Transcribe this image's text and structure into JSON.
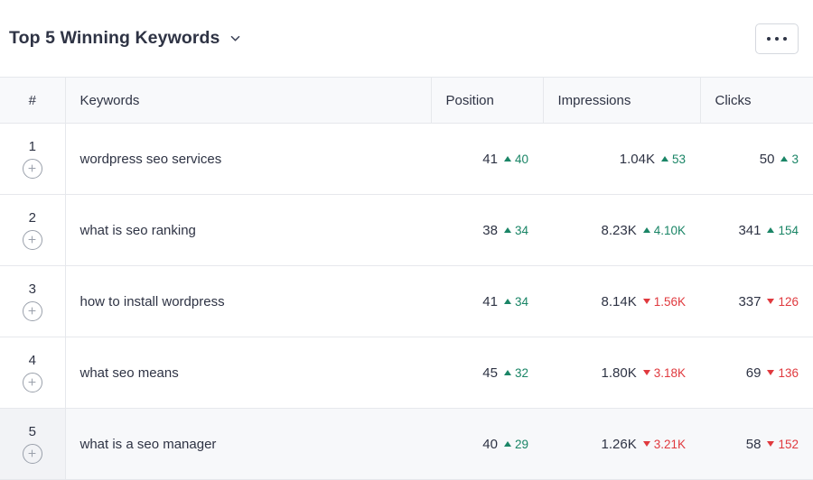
{
  "card": {
    "title": "Top 5 Winning Keywords",
    "title_chevron_icon": "chevron-down-icon",
    "menu_icon": "ellipsis-horizontal-icon"
  },
  "colors": {
    "positive": "#1a8566",
    "negative": "#e0393e",
    "text": "#2e3344",
    "header_bg": "#f8f9fb",
    "border": "#e6e8ec",
    "row_hover_bg": "#f7f8fa"
  },
  "table": {
    "columns": [
      {
        "key": "index",
        "label": "#"
      },
      {
        "key": "keyword",
        "label": "Keywords"
      },
      {
        "key": "position",
        "label": "Position"
      },
      {
        "key": "impressions",
        "label": "Impressions"
      },
      {
        "key": "clicks",
        "label": "Clicks"
      }
    ],
    "add_icon": "plus-circle-icon",
    "rows": [
      {
        "index": "1",
        "keyword": "wordpress seo services",
        "position": {
          "value": "41",
          "delta": "40",
          "direction": "up"
        },
        "impressions": {
          "value": "1.04K",
          "delta": "53",
          "direction": "up"
        },
        "clicks": {
          "value": "50",
          "delta": "3",
          "direction": "up"
        },
        "hover": false
      },
      {
        "index": "2",
        "keyword": "what is seo ranking",
        "position": {
          "value": "38",
          "delta": "34",
          "direction": "up"
        },
        "impressions": {
          "value": "8.23K",
          "delta": "4.10K",
          "direction": "up"
        },
        "clicks": {
          "value": "341",
          "delta": "154",
          "direction": "up"
        },
        "hover": false
      },
      {
        "index": "3",
        "keyword": "how to install wordpress",
        "position": {
          "value": "41",
          "delta": "34",
          "direction": "up"
        },
        "impressions": {
          "value": "8.14K",
          "delta": "1.56K",
          "direction": "down"
        },
        "clicks": {
          "value": "337",
          "delta": "126",
          "direction": "down"
        },
        "hover": false
      },
      {
        "index": "4",
        "keyword": "what seo means",
        "position": {
          "value": "45",
          "delta": "32",
          "direction": "up"
        },
        "impressions": {
          "value": "1.80K",
          "delta": "3.18K",
          "direction": "down"
        },
        "clicks": {
          "value": "69",
          "delta": "136",
          "direction": "down"
        },
        "hover": false
      },
      {
        "index": "5",
        "keyword": "what is a seo manager",
        "position": {
          "value": "40",
          "delta": "29",
          "direction": "up"
        },
        "impressions": {
          "value": "1.26K",
          "delta": "3.21K",
          "direction": "down"
        },
        "clicks": {
          "value": "58",
          "delta": "152",
          "direction": "down"
        },
        "hover": true
      }
    ]
  }
}
